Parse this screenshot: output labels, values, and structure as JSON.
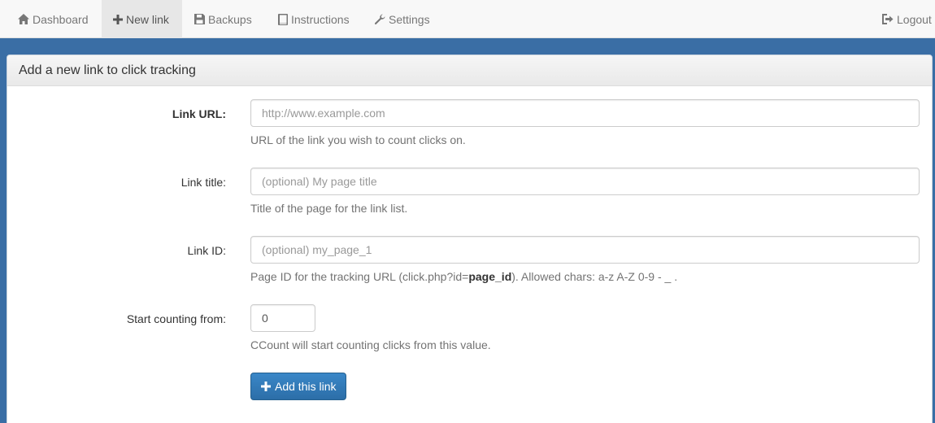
{
  "nav": {
    "items": [
      {
        "label": "Dashboard",
        "icon": "home-icon"
      },
      {
        "label": "New link",
        "icon": "plus-icon",
        "active": true
      },
      {
        "label": "Backups",
        "icon": "save-icon"
      },
      {
        "label": "Instructions",
        "icon": "book-icon"
      },
      {
        "label": "Settings",
        "icon": "wrench-icon"
      }
    ],
    "logout": {
      "label": "Logout",
      "icon": "logout-icon"
    }
  },
  "panel": {
    "title": "Add a new link to click tracking"
  },
  "form": {
    "url": {
      "label": "Link URL:",
      "placeholder": "http://www.example.com",
      "value": "",
      "help": "URL of the link you wish to count clicks on."
    },
    "title": {
      "label": "Link title:",
      "placeholder": "(optional) My page title",
      "value": "",
      "help": "Title of the page for the link list."
    },
    "id": {
      "label": "Link ID:",
      "placeholder": "(optional) my_page_1",
      "value": "",
      "help_pre": "Page ID for the tracking URL (click.php?id=",
      "help_bold": "page_id",
      "help_post": "). Allowed chars: a-z A-Z 0-9 - _ ."
    },
    "start": {
      "label": "Start counting from:",
      "value": "0",
      "help": "CCount will start counting clicks from this value."
    },
    "submit_label": "Add this link"
  },
  "colors": {
    "header_band": "#3a6ea5",
    "button": "#337ab7"
  }
}
